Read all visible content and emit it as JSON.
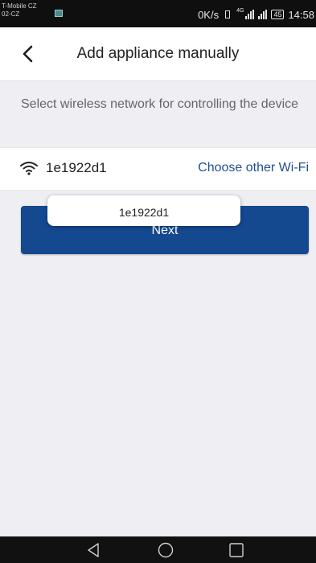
{
  "status_bar": {
    "carrier_line1": "T-Mobile CZ",
    "carrier_line2": "02-CZ",
    "net_speed": "0K/s",
    "network_type": "4G",
    "battery": "45",
    "time": "14:58"
  },
  "header": {
    "title": "Add appliance manually",
    "back_icon": "chevron-left-icon"
  },
  "instruction": "Select wireless network for controlling the device",
  "wifi": {
    "icon": "wifi-icon",
    "ssid": "1e1922d1",
    "choose_other_label": "Choose other Wi-Fi"
  },
  "next_button": {
    "label": "Next"
  },
  "toast": {
    "text": "1e1922d1"
  },
  "nav_bar": {
    "back_icon": "triangle-back-icon",
    "home_icon": "circle-home-icon",
    "recents_icon": "square-recents-icon"
  },
  "colors": {
    "accent": "#14488f",
    "link": "#1f4f95",
    "background": "#efeff3"
  }
}
